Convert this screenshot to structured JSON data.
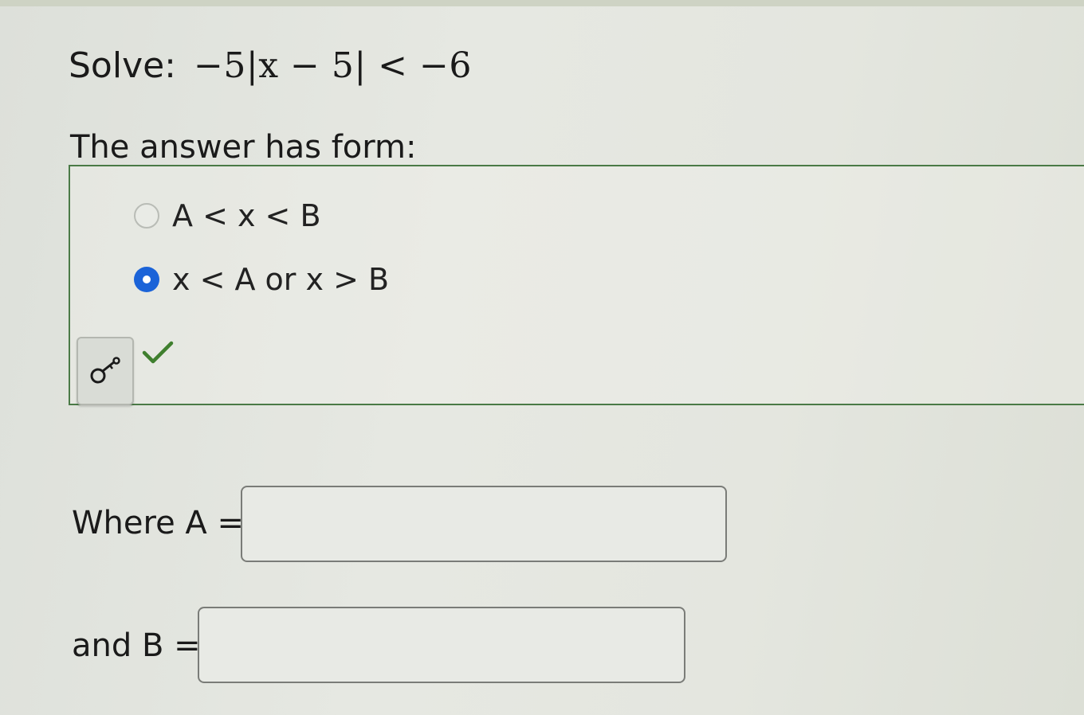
{
  "question": {
    "label": "Solve:",
    "expression": "−5|x − 5| < −6"
  },
  "form_prompt": "The answer has form:",
  "choices": [
    {
      "label": "A < x < B",
      "selected": false
    },
    {
      "label": "x < A or x > B",
      "selected": true
    }
  ],
  "answer_key_icon": "key-icon",
  "result_icon": "checkmark-icon",
  "colors": {
    "radio_selected": "#1b63d8",
    "check": "#3f7f2e",
    "box_border": "#4a7a46"
  },
  "fields": {
    "a_label": "Where A =",
    "a_value": "",
    "b_label": "and B =",
    "b_value": ""
  }
}
